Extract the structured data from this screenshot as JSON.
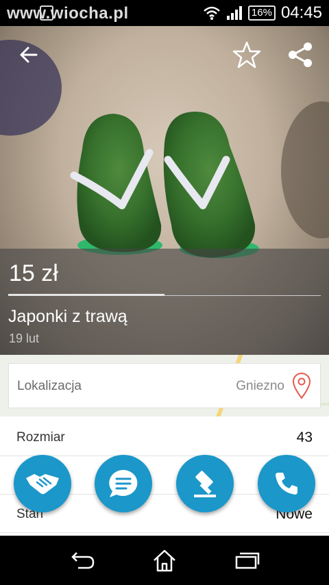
{
  "status_bar": {
    "watermark": "www.wiocha.pl",
    "battery": "16%",
    "time": "04:45",
    "icons": [
      "shopping-bag-icon",
      "wifi-icon",
      "signal-icon",
      "battery-icon"
    ]
  },
  "toolbar": {
    "icons": [
      "back-arrow-icon",
      "star-icon",
      "share-icon"
    ]
  },
  "listing": {
    "price": "15 zł",
    "title": "Japonki z trawą",
    "date": "19  lut"
  },
  "location": {
    "label": "Lokalizacja",
    "value": "Gniezno",
    "icon": "location-pin-icon"
  },
  "details": [
    {
      "label": "Rozmiar",
      "value": "43"
    },
    {
      "label": "Stan",
      "value": "Nowe"
    }
  ],
  "actions": [
    {
      "name": "handshake",
      "icon": "handshake-icon"
    },
    {
      "name": "message",
      "icon": "chat-bubble-icon"
    },
    {
      "name": "auction",
      "icon": "gavel-icon"
    },
    {
      "name": "call",
      "icon": "phone-icon"
    }
  ],
  "colors": {
    "accent": "#1b97c9",
    "pin": "#e8574e"
  },
  "navigation": {
    "icons": [
      "back-icon",
      "home-icon",
      "recent-apps-icon"
    ]
  }
}
